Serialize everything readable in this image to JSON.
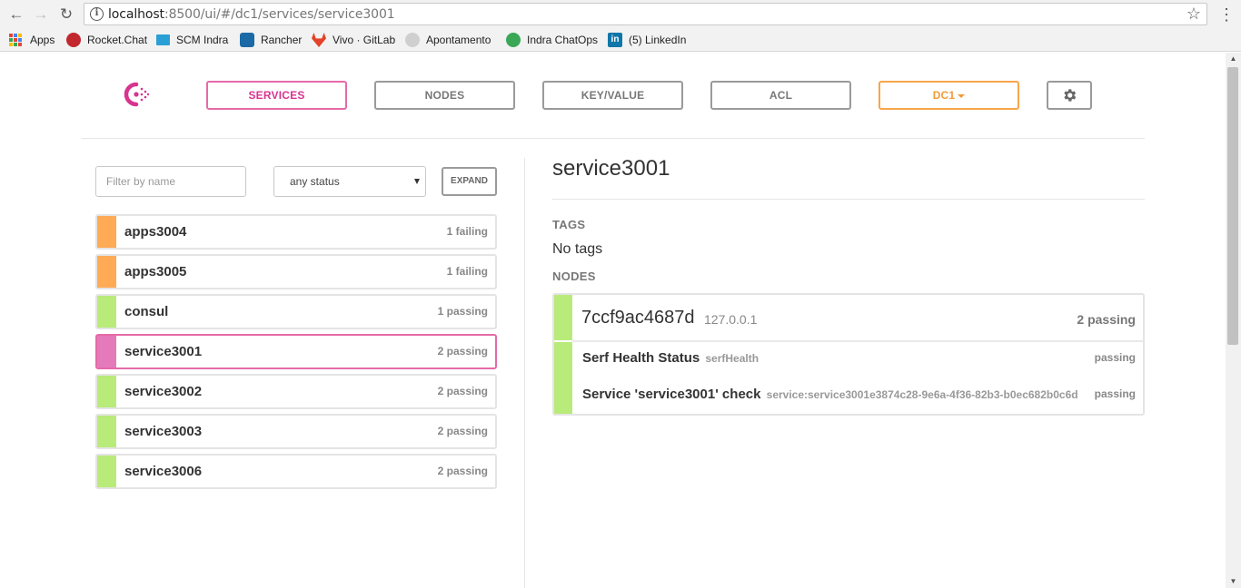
{
  "browser": {
    "url_host": "localhost",
    "url_path": ":8500/ui/#/dc1/services/service3001",
    "bookmarks": [
      {
        "label": "Apps",
        "icon": "apps-grid-icon"
      },
      {
        "label": "Rocket.Chat",
        "icon": "rocketchat-icon"
      },
      {
        "label": "SCM Indra",
        "icon": "scm-indra-icon"
      },
      {
        "label": "Rancher",
        "icon": "rancher-icon"
      },
      {
        "label": "Vivo · GitLab",
        "icon": "gitlab-icon"
      },
      {
        "label": "Apontamento",
        "icon": "apontamento-icon"
      },
      {
        "label": "Indra ChatOps",
        "icon": "chatops-icon"
      },
      {
        "label": "(5) LinkedIn",
        "icon": "linkedin-icon"
      }
    ]
  },
  "nav": {
    "tabs": [
      "SERVICES",
      "NODES",
      "KEY/VALUE",
      "ACL"
    ],
    "active_tab": "SERVICES",
    "datacenter": "DC1",
    "colors": {
      "active": "#d8338f",
      "datacenter": "#f39a37",
      "passing": "#b8eb7a",
      "failing": "#ffaa55",
      "selected": "#e57abb"
    }
  },
  "filters": {
    "name_placeholder": "Filter by name",
    "status_value": "any status",
    "expand_label": "EXPAND"
  },
  "services": [
    {
      "name": "apps3004",
      "status": "1 failing",
      "state": "failing"
    },
    {
      "name": "apps3005",
      "status": "1 failing",
      "state": "failing"
    },
    {
      "name": "consul",
      "status": "1 passing",
      "state": "passing"
    },
    {
      "name": "service3001",
      "status": "2 passing",
      "state": "selected"
    },
    {
      "name": "service3002",
      "status": "2 passing",
      "state": "passing"
    },
    {
      "name": "service3003",
      "status": "2 passing",
      "state": "passing"
    },
    {
      "name": "service3006",
      "status": "2 passing",
      "state": "passing"
    }
  ],
  "detail": {
    "title": "service3001",
    "tags_label": "TAGS",
    "tags_value": "No tags",
    "nodes_label": "NODES",
    "node": {
      "name": "7ccf9ac4687d",
      "address": "127.0.0.1",
      "status": "2 passing",
      "checks": [
        {
          "name": "Serf Health Status",
          "id": "serfHealth",
          "status": "passing"
        },
        {
          "name": "Service 'service3001' check",
          "id": "service:service3001e3874c28-9e6a-4f36-82b3-b0ec682b0c6d",
          "status": "passing"
        }
      ]
    }
  }
}
